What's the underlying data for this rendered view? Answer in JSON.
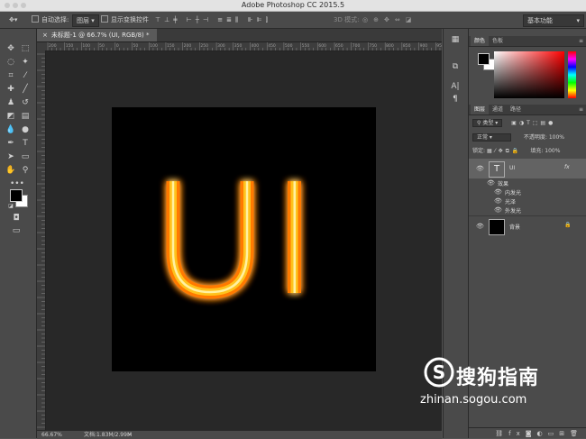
{
  "app": {
    "title": "Adobe Photoshop CC 2015.5"
  },
  "options": {
    "auto_select_label": "自动选择:",
    "auto_select_value": "图层",
    "show_transform_label": "显示变换控件",
    "mode3d_label": "3D 模式:",
    "workspace": "基本功能"
  },
  "document": {
    "tab_title": "未标题-1 @ 66.7% (UI, RGB/8) *",
    "text_content": "UI",
    "glow_color": "#ff8a00",
    "fill_color": "#ffcf2e"
  },
  "rulers": {
    "top": [
      "200",
      "150",
      "100",
      "50",
      "0",
      "50",
      "100",
      "150",
      "200",
      "250",
      "300",
      "350",
      "400",
      "450",
      "500",
      "550",
      "600",
      "650",
      "700",
      "750",
      "800",
      "850",
      "900",
      "950"
    ]
  },
  "status": {
    "zoom": "66.67%",
    "doc_size": "文档:1.83M/2.99M"
  },
  "color_panel": {
    "tabs": [
      "颜色",
      "色板"
    ],
    "fg": "#000000",
    "bg": "#ffffff"
  },
  "layers_panel": {
    "tabs": [
      "图层",
      "通道",
      "路径"
    ],
    "filter_label": "类型",
    "blend_mode": "正常",
    "opacity_label": "不透明度:",
    "opacity_value": "100%",
    "lock_label": "锁定:",
    "fill_label": "填充:",
    "fill_value": "100%",
    "layers": [
      {
        "name": "UI",
        "thumb": "T",
        "fx": "fx"
      },
      {
        "name": "背景"
      }
    ],
    "effects_label": "效果",
    "effects": [
      "内发光",
      "光泽",
      "外发光"
    ]
  },
  "watermark": {
    "text": "搜狗指南",
    "url": "zhinan.sogou.com",
    "logo": "S"
  }
}
